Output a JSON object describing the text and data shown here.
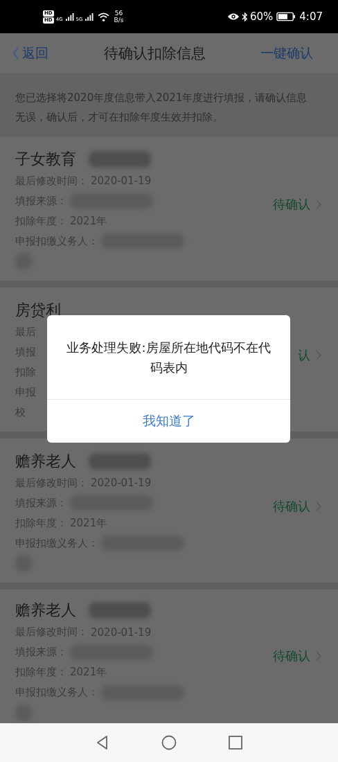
{
  "status_bar": {
    "hd_top": "HD",
    "hd_bottom": "HD",
    "net_1": "4G",
    "net_2": "5G",
    "speed": "56",
    "speed_unit": "B/s",
    "battery": "60%",
    "time": "4:07"
  },
  "header": {
    "back": "返回",
    "title": "待确认扣除信息",
    "action": "一键确认"
  },
  "notice": "您已选择将2020年度信息带入2021年度进行填报，请确认信息无误，确认后，才可在扣除年度生效并扣除。",
  "cards": [
    {
      "title": "子女教育",
      "redacted": true,
      "modified_label": "最后修改时间：",
      "modified": "2020-01-19",
      "source_label": "填报来源：",
      "year_label": "扣除年度：",
      "year": "2021年",
      "agent_label": "申报扣缴义务人：",
      "status": "待确认"
    },
    {
      "title": "房贷利",
      "redacted": false,
      "modified_label": "最后",
      "source_label": "填报",
      "year_label": "扣除",
      "agent_label": "申报",
      "agent_tail": "校",
      "status": "认"
    },
    {
      "title": "赡养老人",
      "redacted": true,
      "modified_label": "最后修改时间：",
      "modified": "2020-01-19",
      "source_label": "填报来源：",
      "year_label": "扣除年度：",
      "year": "2021年",
      "agent_label": "申报扣缴义务人：",
      "status": "待确认"
    },
    {
      "title": "赡养老人",
      "redacted": true,
      "modified_label": "最后修改时间：",
      "modified": "2020-01-19",
      "source_label": "填报来源：",
      "year_label": "扣除年度：",
      "year": "2021年",
      "agent_label": "申报扣缴义务人：",
      "status": "待确认"
    }
  ],
  "dialog": {
    "message": "业务处理失败:房屋所在地代码不在代码表内",
    "button": "我知道了"
  }
}
